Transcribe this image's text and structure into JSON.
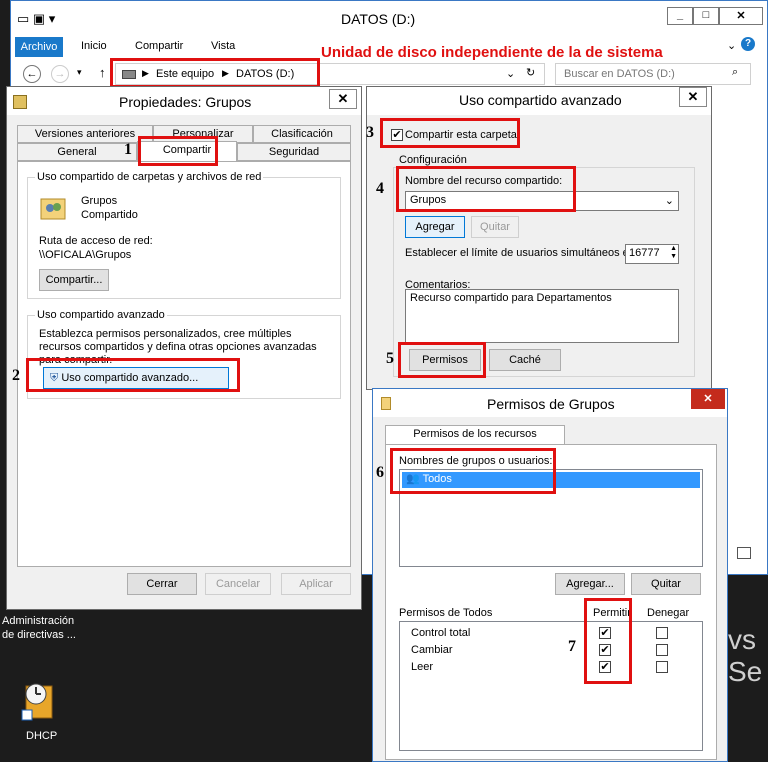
{
  "explorer": {
    "title": "DATOS (D:)",
    "ribbon_tabs": [
      "Archivo",
      "Inicio",
      "Compartir",
      "Vista"
    ],
    "breadcrumb": [
      "Este equipo",
      "DATOS (D:)"
    ],
    "search_placeholder": "Buscar en DATOS (D:)",
    "annotation": "Unidad de disco independiente de la de sistema"
  },
  "props": {
    "title": "Propiedades: Grupos",
    "tabs_row1": [
      "Versiones anteriores",
      "Personalizar",
      "Clasificación"
    ],
    "tabs_row2": [
      "General",
      "Compartir",
      "Seguridad"
    ],
    "net_group_title": "Uso compartido de carpetas y archivos de red",
    "share_name": "Grupos",
    "share_status": "Compartido",
    "path_label": "Ruta de acceso de red:",
    "path_value": "\\\\OFICALA\\Grupos",
    "share_button": "Compartir...",
    "adv_group_title": "Uso compartido avanzado",
    "adv_desc": "Establezca permisos personalizados, cree múltiples recursos compartidos y defina otras opciones avanzadas para compartir.",
    "adv_button": "Uso compartido avanzado...",
    "ok": "Cerrar",
    "cancel": "Cancelar",
    "apply": "Aplicar"
  },
  "advanced": {
    "title": "Uso compartido avanzado",
    "share_checkbox": "Compartir esta carpeta",
    "config_title": "Configuración",
    "name_label": "Nombre del recurso compartido:",
    "name_value": "Grupos",
    "add": "Agregar",
    "remove": "Quitar",
    "limit_label": "Establecer el límite de usuarios simultáneos en:",
    "limit_value": "16777",
    "comments_label": "Comentarios:",
    "comments_value": "Recurso compartido para Departamentos",
    "permissions": "Permisos",
    "cache": "Caché"
  },
  "perms": {
    "title": "Permisos de Grupos",
    "tab": "Permisos de los recursos compartidos",
    "groups_label": "Nombres de grupos o usuarios:",
    "group_item": "Todos",
    "add": "Agregar...",
    "remove": "Quitar",
    "perm_header": "Permisos de Todos",
    "allow": "Permitir",
    "deny": "Denegar",
    "rows": [
      {
        "name": "Control total",
        "allow": true,
        "deny": false
      },
      {
        "name": "Cambiar",
        "allow": true,
        "deny": false
      },
      {
        "name": "Leer",
        "allow": true,
        "deny": false
      }
    ]
  },
  "desktop": {
    "icon1_line1": "Administración",
    "icon1_line2": "de directivas ...",
    "icon2": "DHCP",
    "bg_text": "vs Se"
  },
  "steps": [
    "1",
    "2",
    "3",
    "4",
    "5",
    "6",
    "7"
  ]
}
